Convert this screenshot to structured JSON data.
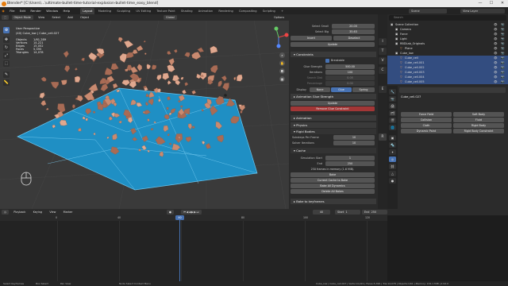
{
  "window": {
    "title": "Blender* [C:\\Users\\...\\ultimate-bullet-time-tutorial-explosion-bullet-time_easy_blend]",
    "minimize": "—",
    "maximize": "☐",
    "close": "✕"
  },
  "menu": {
    "items": [
      "File",
      "Edit",
      "Render",
      "Window",
      "Help"
    ],
    "workspaces": [
      "Layout",
      "Modeling",
      "Sculpting",
      "UV Editing",
      "Texture Paint",
      "Shading",
      "Animation",
      "Rendering",
      "Compositing",
      "Scripting"
    ],
    "active_workspace": "Layout",
    "scene_label": "Scene",
    "viewlayer_label": "View Layer"
  },
  "viewport": {
    "mode": "Object Mode",
    "menus": [
      "View",
      "Select",
      "Add",
      "Object"
    ],
    "transform": "Global",
    "options": "Options",
    "overlay": {
      "view_name": "User Perspective",
      "collection": "(40) Cube_low | Cube_cell.027",
      "stats": [
        {
          "label": "Objects",
          "value": "1/61,289"
        },
        {
          "label": "Vertices",
          "value": "14,221"
        },
        {
          "label": "Edges",
          "value": "15,052"
        },
        {
          "label": "Faces",
          "value": "5,395"
        },
        {
          "label": "Triangles",
          "value": "14,078"
        }
      ]
    },
    "tools": [
      "cursor",
      "move",
      "rotate",
      "scale",
      "transform",
      "annotate",
      "measure"
    ],
    "nav_buttons": [
      "X",
      "Y",
      "✋",
      "🔍",
      "🎥",
      "▦"
    ]
  },
  "props_panel": {
    "top_fields": [
      {
        "label": "Select Small",
        "value": "20.00"
      },
      {
        "label": "Select Big",
        "value": "35.63"
      }
    ],
    "buttons_top": [
      "Invert",
      "Deselect",
      "Update"
    ],
    "constraints_title": "Constraints",
    "breakable_label": "Breakable",
    "glue_strength": {
      "label": "Glue Strength",
      "value": "500.00"
    },
    "iterations": {
      "label": "Iterations",
      "value": "100"
    },
    "search_dist": {
      "label": "Search Dist",
      "value": "0.05"
    },
    "percentage": {
      "label": "Percentage",
      "value": "0.00"
    },
    "display_label": "Display",
    "display_options": [
      "None",
      "Glue",
      "Spring"
    ],
    "animation_glue": "Animation Glue Strength",
    "update_btn": "Update",
    "remove_glue": "Remove Glue Constraint",
    "animation_title": "Animation",
    "physics_title": "Physics",
    "rigid_bodies_title": "Rigid Bodies",
    "substeps": {
      "label": "Substeps Per Frame",
      "value": "10"
    },
    "solver_iter": {
      "label": "Solver Iterations",
      "value": "10"
    },
    "cache_title": "Cache",
    "sim_start": {
      "label": "Simulation Start",
      "value": "1"
    },
    "end": {
      "label": "End",
      "value": "250"
    },
    "cache_info": "250 frames in memory (1.6 MiB).",
    "cache_buttons": [
      "Bake",
      "Current Cache to Bake",
      "Bake All Dynamics",
      "Delete All Bakes"
    ],
    "bake_keyframes": "Bake to keyframes"
  },
  "outliner": {
    "search_placeholder": "Search",
    "rows": [
      {
        "name": "Scene Collection",
        "indent": 0,
        "sel": false
      },
      {
        "name": "Camera",
        "indent": 1,
        "sel": false
      },
      {
        "name": "Force",
        "indent": 1,
        "sel": false
      },
      {
        "name": "Light",
        "indent": 1,
        "sel": false
      },
      {
        "name": "RBDLab_Originals",
        "indent": 1,
        "sel": false
      },
      {
        "name": "Plane",
        "indent": 2,
        "sel": false
      },
      {
        "name": "Cube_low",
        "indent": 1,
        "sel": false
      },
      {
        "name": "Cube_cell",
        "indent": 2,
        "sel": true
      },
      {
        "name": "Cube_cell.001",
        "indent": 2,
        "sel": true
      },
      {
        "name": "Cube_cell.002",
        "indent": 2,
        "sel": true
      },
      {
        "name": "Cube_cell.003",
        "indent": 2,
        "sel": true
      },
      {
        "name": "Cube_cell.004",
        "indent": 2,
        "sel": true
      },
      {
        "name": "Cube_cell.005",
        "indent": 2,
        "sel": true
      }
    ]
  },
  "object_props": {
    "object_name": "Cube_cell.027",
    "buttons": [
      [
        "Force Field",
        "Soft Body"
      ],
      [
        "Collision",
        "Fluid"
      ],
      [
        "Cloth",
        "Rigid Body"
      ],
      [
        "Dynamic Paint",
        "Rigid Body Constraint"
      ]
    ]
  },
  "timeline": {
    "menus": [
      "Playback",
      "Keying",
      "View",
      "Marker"
    ],
    "current_frame": "40",
    "start_label": "Start",
    "start": "1",
    "end_label": "End",
    "end": "250",
    "ticks": [
      "0",
      "40",
      "60",
      "80",
      "100",
      "120",
      "140",
      "160"
    ]
  },
  "statusbar": {
    "left": [
      "Select Keyframes",
      "Box Select",
      "Pan View"
    ],
    "center": "Node Select Context Menu",
    "right": "Cube_low | Cube_cell.027 | Verts:14,221 | Faces:5,395 | Tris:14,078 | Objects:1/61 | Memory: 134.1 MiB | 2.92.0"
  },
  "colors": {
    "plane": "#1f8fc4",
    "fragment": "#c98a70",
    "accent": "#4772b3",
    "danger": "#a23636",
    "selected": "#334d80"
  }
}
